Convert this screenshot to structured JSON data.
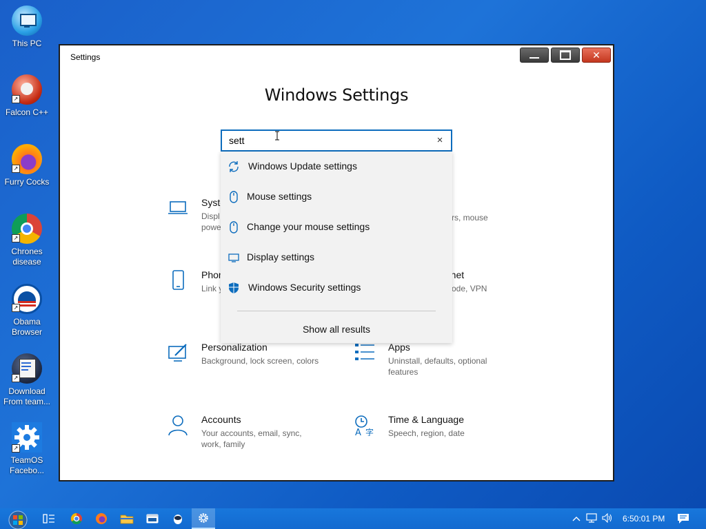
{
  "desktop": {
    "icons": [
      {
        "label": "This PC"
      },
      {
        "label": "Falcon C++"
      },
      {
        "label": "Furry Cocks"
      },
      {
        "label": "Chrones disease"
      },
      {
        "label": "Obama Browser"
      },
      {
        "label": "Download From team..."
      },
      {
        "label": "TeamOS Facebo..."
      }
    ]
  },
  "window": {
    "title": "Settings",
    "heading": "Windows Settings",
    "search": {
      "value": "sett",
      "clear_icon": "×"
    },
    "suggestions": [
      {
        "label": "Windows Update settings",
        "icon": "refresh-icon"
      },
      {
        "label": "Mouse settings",
        "icon": "mouse-icon"
      },
      {
        "label": "Change your mouse settings",
        "icon": "mouse-icon"
      },
      {
        "label": "Display settings",
        "icon": "monitor-icon"
      },
      {
        "label": "Windows Security settings",
        "icon": "shield-icon"
      }
    ],
    "show_all_label": "Show all results",
    "categories": [
      {
        "title": "Syste",
        "desc": "Displ\npowe"
      },
      {
        "title": "",
        "desc": "rs, mouse"
      },
      {
        "title": "Phon",
        "desc": "Link y"
      },
      {
        "title": "rnet",
        "desc": "ode, VPN"
      },
      {
        "title": "Personalization",
        "desc": "Background, lock screen, colors"
      },
      {
        "title": "Apps",
        "desc": "Uninstall, defaults, optional features"
      },
      {
        "title": "Accounts",
        "desc": "Your accounts, email, sync, work, family"
      },
      {
        "title": "Time & Language",
        "desc": "Speech, region, date"
      }
    ]
  },
  "taskbar": {
    "clock": "6:50:01 PM"
  },
  "colors": {
    "accent": "#0c6cbd",
    "desktop": "#1e73d8",
    "taskbar": "#1877dc"
  }
}
